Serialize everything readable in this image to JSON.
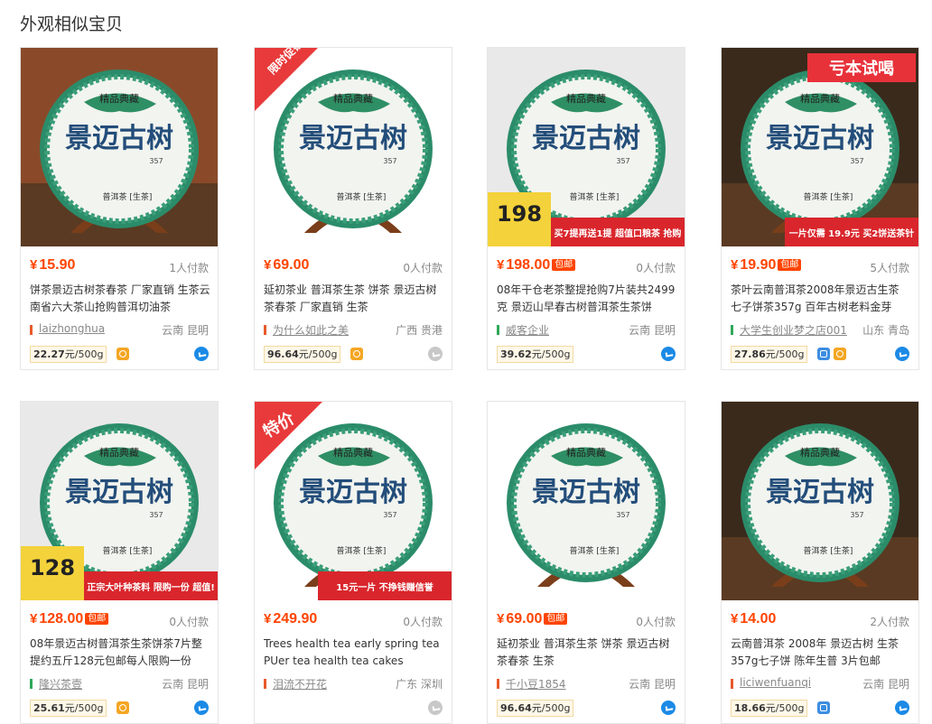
{
  "section": {
    "title": "外观相似宝贝"
  },
  "colors": {
    "price": "#ff4400",
    "badge_bg": "#ff4400",
    "border": "#e6e6e6"
  },
  "items": [
    {
      "price": "15.90",
      "free_post": "",
      "paid": "1人付款",
      "title": "饼茶景迈古树茶春茶 厂家直销 生茶云南省六大茶山抢购普洱切油茶",
      "shop": "laizhonghua",
      "location": "云南 昆明",
      "unit_price": "22.27",
      "unit": "元/500g",
      "badges": [
        "gold"
      ],
      "online": true,
      "bar_color": "#e85a2b",
      "image": {
        "bg": "#8a4a2a",
        "tag": "",
        "banner": ""
      }
    },
    {
      "price": "69.00",
      "free_post": "",
      "paid": "0人付款",
      "title": "延初茶业 普洱茶生茶 饼茶 景迈古树茶春茶 厂家直销 生茶",
      "shop": "为什么如此之美",
      "location": "广西 贵港",
      "unit_price": "96.64",
      "unit": "元/500g",
      "badges": [
        "gold"
      ],
      "online": false,
      "bar_color": "#e85a2b",
      "image": {
        "bg": "#ffffff",
        "tag": "限时促销",
        "banner": ""
      }
    },
    {
      "price": "198.00",
      "free_post": "包邮",
      "paid": "0人付款",
      "title": "08年干仓老茶整提抢购7片装共2499克 景迈山早春古树普洱茶生茶饼",
      "shop": "威客企业",
      "location": "云南 昆明",
      "unit_price": "39.62",
      "unit": "元/500g",
      "badges": [],
      "online": true,
      "bar_color": "#2fa85a",
      "image": {
        "bg": "#e9e9e9",
        "tag": "198",
        "banner": "买7提再送1提 超值口粮茶 抢购"
      }
    },
    {
      "price": "19.90",
      "free_post": "包邮",
      "paid": "5人付款",
      "title": "茶叶云南普洱茶2008年景迈古生茶 七子饼茶357g 百年古树老料金芽",
      "shop": "大学生创业梦之店001",
      "location": "山东 青岛",
      "unit_price": "27.86",
      "unit": "元/500g",
      "badges": [
        "blue",
        "gold"
      ],
      "online": true,
      "bar_color": "#2fa85a",
      "image": {
        "bg": "#3a2a1c",
        "tag": "亏本试喝",
        "banner": "一片仅需 19.9元 买2饼送茶针"
      }
    },
    {
      "price": "128.00",
      "free_post": "包邮",
      "paid": "0人付款",
      "title": "08年景迈古树普洱茶生茶饼茶7片整提约五斤128元包邮每人限购一份",
      "shop": "隆兴茶壹",
      "location": "云南 昆明",
      "unit_price": "25.61",
      "unit": "元/500g",
      "badges": [
        "gold"
      ],
      "online": true,
      "bar_color": "#2fa85a",
      "image": {
        "bg": "#e9e9e9",
        "tag": "128",
        "banner": "正宗大叶种茶料 限购一份 超值!"
      }
    },
    {
      "price": "249.90",
      "free_post": "",
      "paid": "0人付款",
      "title": "Trees health tea early spring tea PUer tea health tea cakes",
      "shop": "泪流不开花",
      "location": "广东 深圳",
      "unit_price": "",
      "unit": "",
      "badges": [],
      "online": false,
      "bar_color": "#e85a2b",
      "image": {
        "bg": "#ffffff",
        "tag": "特价",
        "banner": "15元一片 不挣钱赚信誉"
      }
    },
    {
      "price": "69.00",
      "free_post": "包邮",
      "paid": "0人付款",
      "title": "延初茶业 普洱茶生茶 饼茶 景迈古树茶春茶 生茶",
      "shop": "千小豆1854",
      "location": "云南 昆明",
      "unit_price": "96.64",
      "unit": "元/500g",
      "badges": [],
      "online": true,
      "bar_color": "#e85a2b",
      "image": {
        "bg": "#ffffff",
        "tag": "",
        "banner": ""
      }
    },
    {
      "price": "14.00",
      "free_post": "",
      "paid": "2人付款",
      "title": "云南普洱茶 2008年 景迈古树 生茶357g七子饼 陈年生普 3片包邮",
      "shop": "liciwenfuanqi",
      "location": "云南 昆明",
      "unit_price": "18.66",
      "unit": "元/500g",
      "badges": [
        "blue"
      ],
      "online": true,
      "bar_color": "#e85a2b",
      "image": {
        "bg": "#3a2a1c",
        "tag": "",
        "banner": ""
      }
    }
  ],
  "cake_text": {
    "brand": "精品典藏",
    "name": "景迈古树",
    "weight": "357",
    "type": "普洱茶 [生茶]"
  }
}
